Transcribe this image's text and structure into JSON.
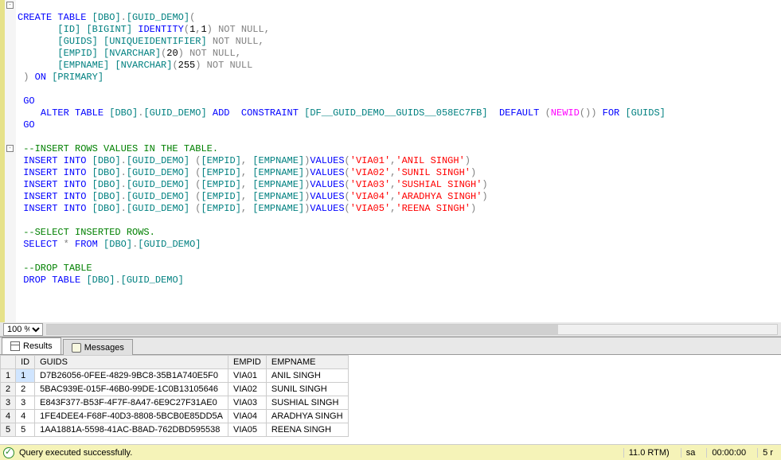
{
  "zoom": "100 %",
  "tabs": {
    "results": "Results",
    "messages": "Messages"
  },
  "status": {
    "message": "Query executed successfully.",
    "server_version": "11.0 RTM)",
    "user": "sa",
    "elapsed": "00:00:00",
    "rowcount": "5 r"
  },
  "code": {
    "l1a": "CREATE",
    "l1b": "TABLE",
    "l1c": "[DBO]",
    "l1d": ".",
    "l1e": "[GUID_DEMO]",
    "l1f": "(",
    "l2a": "[ID]",
    "l2b": "[BIGINT]",
    "l2c": "IDENTITY",
    "l2d": "(",
    "l2e": "1",
    "l2f": ",",
    "l2g": "1",
    "l2h": ")",
    "l2i": "NOT NULL",
    "l2j": ",",
    "l3a": "[GUIDS]",
    "l3b": "[UNIQUEIDENTIFIER]",
    "l3c": "NOT NULL",
    "l3d": ",",
    "l4a": "[EMPID]",
    "l4b": "[NVARCHAR]",
    "l4c": "(",
    "l4d": "20",
    "l4e": ")",
    "l4f": "NOT NULL",
    "l4g": ",",
    "l5a": "[EMPNAME]",
    "l5b": "[NVARCHAR]",
    "l5c": "(",
    "l5d": "255",
    "l5e": ")",
    "l5f": "NOT NULL",
    "l6a": ")",
    "l6b": "ON",
    "l6c": "[PRIMARY]",
    "l8": "GO",
    "l9a": "ALTER",
    "l9b": "TABLE",
    "l9c": "[DBO]",
    "l9d": ".",
    "l9e": "[GUID_DEMO]",
    "l9f": "ADD",
    "l9g": "CONSTRAINT",
    "l9h": "[DF__GUID_DEMO__GUIDS__058EC7FB]",
    "l9i": "DEFAULT",
    "l9j": "(",
    "l9k": "NEWID",
    "l9l": "())",
    "l9m": "FOR",
    "l9n": "[GUIDS]",
    "l10": "GO",
    "l12": "--INSERT ROWS VALUES IN THE TABLE.",
    "insA": "INSERT",
    "insB": "INTO",
    "insC": "[DBO]",
    "insD": ".",
    "insE": "[GUID_DEMO]",
    "insF": "(",
    "insG": "[EMPID]",
    "insH": ",",
    "insI": "[EMPNAME]",
    "insJ": ")",
    "insK": "VALUES",
    "insL": "(",
    "v1a": "'VIA01'",
    "v1b": ",",
    "v1c": "'ANIL SINGH'",
    "v1d": ")",
    "v2a": "'VIA02'",
    "v2c": "'SUNIL SINGH'",
    "v3a": "'VIA03'",
    "v3c": "'SUSHIAL SINGH'",
    "v4a": "'VIA04'",
    "v4c": "'ARADHYA SINGH'",
    "v5a": "'VIA05'",
    "v5c": "'REENA SINGH'",
    "l19": "--SELECT INSERTED ROWS.",
    "l20a": "SELECT",
    "l20b": "*",
    "l20c": "FROM",
    "l20d": "[DBO]",
    "l20e": ".",
    "l20f": "[GUID_DEMO]",
    "l22": "--DROP TABLE",
    "l23a": "DROP",
    "l23b": "TABLE",
    "l23c": "[DBO]",
    "l23d": ".",
    "l23e": "[GUID_DEMO]"
  },
  "grid": {
    "headers": [
      "ID",
      "GUIDS",
      "EMPID",
      "EMPNAME"
    ],
    "rows": [
      {
        "n": "1",
        "id": "1",
        "guid": "D7B26056-0FEE-4829-9BC8-35B1A740E5F0",
        "empid": "VIA01",
        "empname": "ANIL SINGH"
      },
      {
        "n": "2",
        "id": "2",
        "guid": "5BAC939E-015F-46B0-99DE-1C0B13105646",
        "empid": "VIA02",
        "empname": "SUNIL SINGH"
      },
      {
        "n": "3",
        "id": "3",
        "guid": "E843F377-B53F-4F7F-8A47-6E9C27F31AE0",
        "empid": "VIA03",
        "empname": "SUSHIAL SINGH"
      },
      {
        "n": "4",
        "id": "4",
        "guid": "1FE4DEE4-F68F-40D3-8808-5BCB0E85DD5A",
        "empid": "VIA04",
        "empname": "ARADHYA SINGH"
      },
      {
        "n": "5",
        "id": "5",
        "guid": "1AA1881A-5598-41AC-B8AD-762DBD595538",
        "empid": "VIA05",
        "empname": "REENA SINGH"
      }
    ]
  }
}
